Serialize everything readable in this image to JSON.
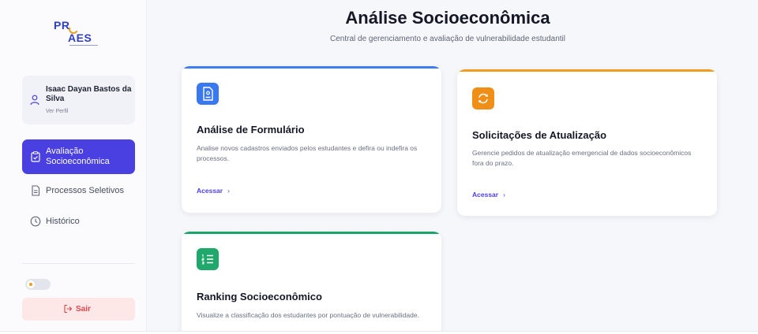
{
  "logo": {
    "top": "PR",
    "bottom": "AES"
  },
  "profile": {
    "name": "Isaac Dayan Bastos da Silva",
    "link": "Ver Perfil"
  },
  "nav": {
    "items": [
      {
        "label": "Avaliação Socioeconômica",
        "icon": "clipboard-check-icon",
        "active": true
      },
      {
        "label": "Processos Seletivos",
        "icon": "document-icon",
        "active": false
      },
      {
        "label": "Histórico",
        "icon": "clock-icon",
        "active": false
      }
    ]
  },
  "theme_toggle": {
    "state": "off"
  },
  "logout": {
    "label": "Sair",
    "icon": "logout-icon"
  },
  "header": {
    "title": "Análise Socioeconômica",
    "subtitle": "Central de gerenciamento e avaliação de vulnerabilidade estudantil"
  },
  "cards": [
    {
      "title": "Análise de Formulário",
      "description": "Analise novos cadastros enviados pelos estudantes e defira ou indefira os processos.",
      "link": "Acessar",
      "icon": "document-user-icon",
      "accent": "#3b7cf0"
    },
    {
      "title": "Solicitações de Atualização",
      "description": "Gerencie pedidos de atualização emergencial de dados socioeconômicos fora do prazo.",
      "link": "Acessar",
      "icon": "refresh-icon",
      "accent": "#f29a1d"
    },
    {
      "title": "Ranking Socioeconômico",
      "description": "Visualize a classificação dos estudantes por pontuação de vulnerabilidade.",
      "icon": "list-ordered-icon",
      "accent": "#1aa46b"
    }
  ],
  "colors": {
    "primary": "#4a3fe0",
    "danger": "#e0474f"
  }
}
